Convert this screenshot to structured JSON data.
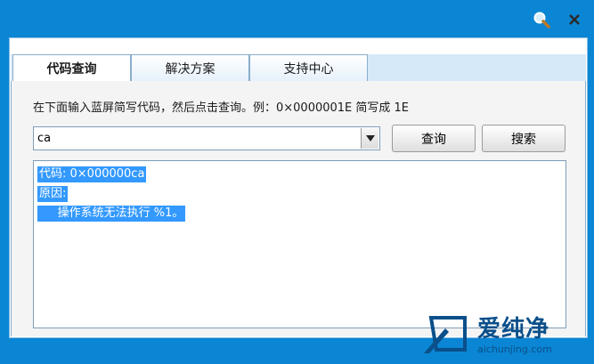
{
  "tabs": [
    {
      "label": "代码查询",
      "active": true
    },
    {
      "label": "解决方案",
      "active": false
    },
    {
      "label": "支持中心",
      "active": false
    }
  ],
  "instruction": "在下面输入蓝屏简写代码，然后点击查询。例：0×0000001E 简写成 1E",
  "combo": {
    "value": "ca"
  },
  "buttons": {
    "query": "查询",
    "search": "搜索"
  },
  "result": {
    "line1": "代码: 0×000000ca",
    "line2": "原因:",
    "line3": "     操作系统无法执行 %1。"
  },
  "watermark": {
    "cn": "爱纯净",
    "url": "aichunjing.com"
  },
  "colors": {
    "titlebar": "#0a86d4",
    "selection": "#3399ff",
    "watermark": "#0a4f8a"
  }
}
